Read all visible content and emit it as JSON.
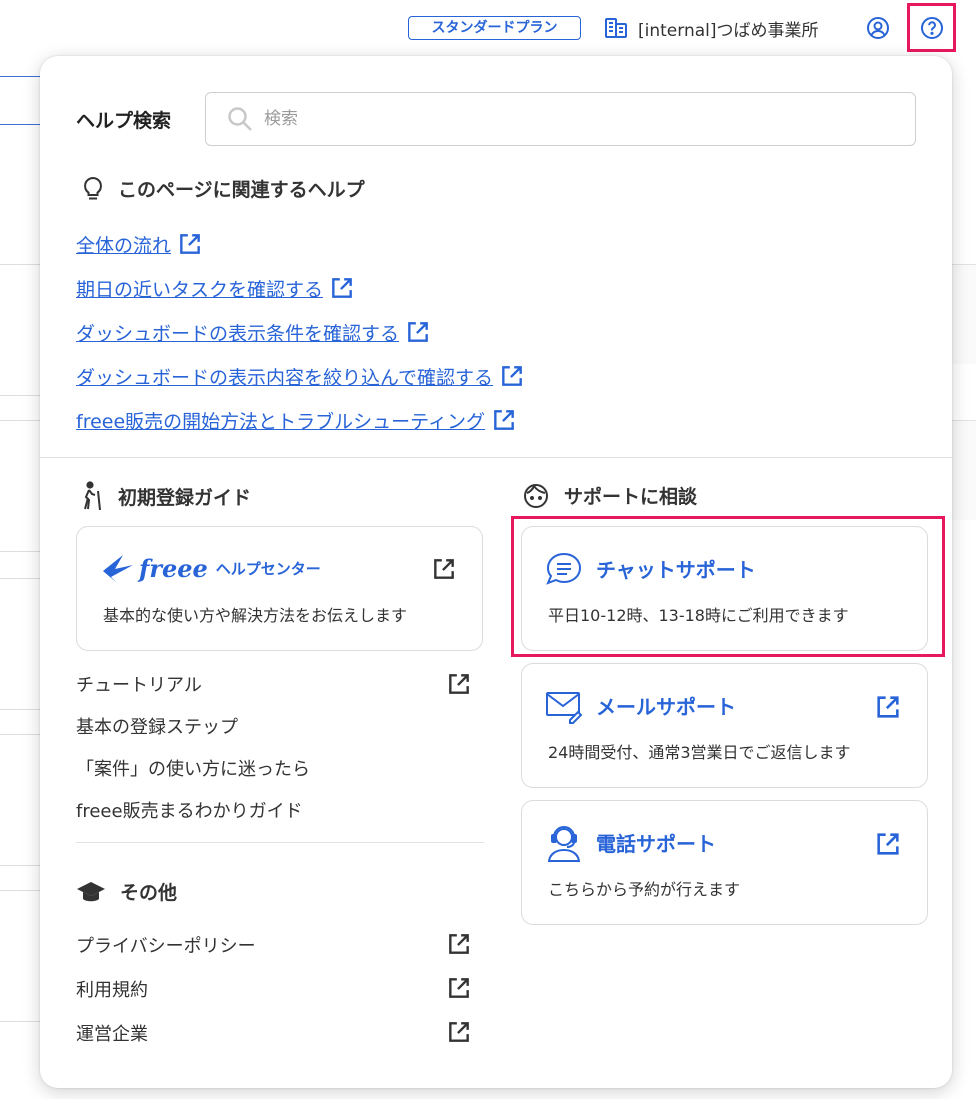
{
  "header": {
    "plan_badge": "スタンダードプラン",
    "office_name": "[internal]つばめ事業所"
  },
  "help": {
    "search_label": "ヘルプ検索",
    "search_placeholder": "検索",
    "related_title": "このページに関連するヘルプ",
    "related_links": [
      "全体の流れ",
      "期日の近いタスクを確認する",
      "ダッシュボードの表示条件を確認する",
      "ダッシュボードの表示内容を絞り込んで確認する",
      "freee販売の開始方法とトラブルシューティング"
    ],
    "guide": {
      "title": "初期登録ガイド",
      "helpcenter_brand": "freee",
      "helpcenter_label": "ヘルプセンター",
      "helpcenter_desc": "基本的な使い方や解決方法をお伝えします",
      "items": [
        "チュートリアル",
        "基本の登録ステップ",
        "「案件」の使い方に迷ったら",
        "freee販売まるわかりガイド"
      ]
    },
    "other": {
      "title": "その他",
      "items": [
        "プライバシーポリシー",
        "利用規約",
        "運営企業"
      ]
    },
    "support": {
      "title": "サポートに相談",
      "cards": [
        {
          "title": "チャットサポート",
          "desc": "平日10-12時、13-18時にご利用できます"
        },
        {
          "title": "メールサポート",
          "desc": "24時間受付、通常3営業日でご返信します"
        },
        {
          "title": "電話サポート",
          "desc": "こちらから予約が行えます"
        }
      ]
    }
  },
  "colors": {
    "accent": "#2864d8",
    "highlight": "#e8185f"
  }
}
